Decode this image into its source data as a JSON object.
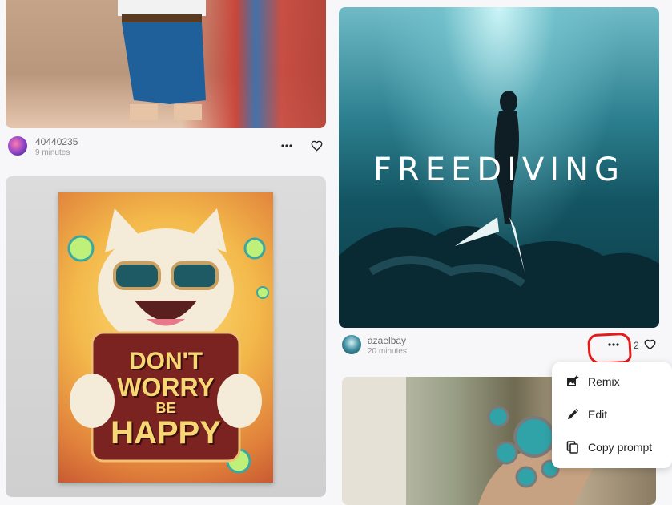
{
  "cards": [
    {
      "user": "40440235",
      "time": "9 minutes"
    },
    {
      "user": "azaelbay",
      "time": "20 minutes",
      "likes": "2",
      "image_title": "FREEDIVING"
    }
  ],
  "poster": {
    "line1": "DON'T",
    "line2": "WORRY",
    "line3": "BE",
    "line4": "HAPPY"
  },
  "menu": {
    "items": [
      {
        "label": "Remix",
        "icon": "image-plus-icon"
      },
      {
        "label": "Edit",
        "icon": "pencil-icon"
      },
      {
        "label": "Copy prompt",
        "icon": "copy-icon"
      }
    ]
  },
  "colors": {
    "accent_highlight": "#e21b1b",
    "background": "#f7f7f9"
  }
}
